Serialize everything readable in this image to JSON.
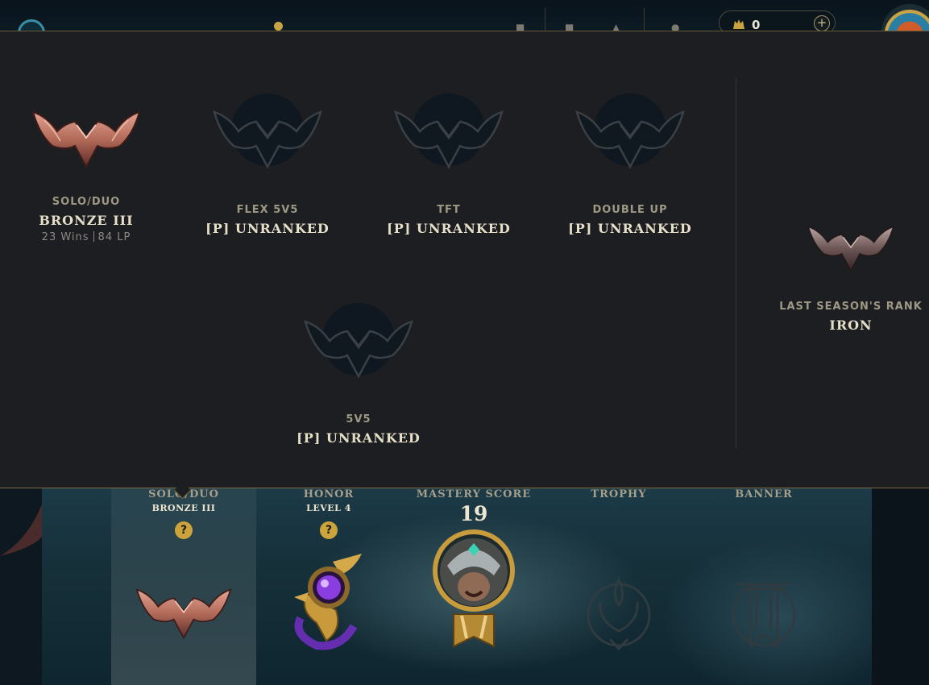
{
  "colors": {
    "panel_bg": "#1d1e22",
    "gold_border": "#7d6a40",
    "bronze": "#b06a56",
    "unranked_emblem": "#0f1820",
    "text_primary": "#e6dfc8",
    "text_secondary": "#9e9985",
    "help_badge": "#cda43c"
  },
  "topbar": {
    "currency": {
      "icon": "riot-points-icon",
      "amount": "0",
      "add_label": "+"
    }
  },
  "panel": {
    "queues": [
      {
        "name": "SOLO/DUO",
        "rank": "BRONZE III",
        "wins": "23 Wins",
        "lp": "84 LP",
        "emblem": "bronze-emblem-icon"
      },
      {
        "name": "FLEX 5V5",
        "rank": "[P] UNRANKED",
        "emblem": "unranked-emblem-icon"
      },
      {
        "name": "TFT",
        "rank": "[P] UNRANKED",
        "emblem": "unranked-emblem-icon"
      },
      {
        "name": "DOUBLE UP",
        "rank": "[P] UNRANKED",
        "emblem": "unranked-emblem-icon"
      },
      {
        "name": "5V5",
        "rank": "[P] UNRANKED",
        "emblem": "unranked-emblem-icon"
      }
    ],
    "last_season": {
      "label": "LAST SEASON'S RANK",
      "rank": "IRON",
      "emblem": "iron-emblem-icon"
    }
  },
  "profile_strip": {
    "slots": [
      {
        "title": "SOLO/DUO",
        "subtitle": "BRONZE III",
        "help": "?",
        "icon": "bronze-emblem-icon"
      },
      {
        "title": "HONOR",
        "subtitle": "LEVEL 4",
        "help": "?",
        "icon": "honor-level-icon"
      },
      {
        "title": "MASTERY SCORE",
        "score": "19",
        "icon": "champion-mastery-icon"
      },
      {
        "title": "TROPHY",
        "icon": "trophy-icon"
      },
      {
        "title": "BANNER",
        "icon": "banner-icon"
      }
    ]
  }
}
